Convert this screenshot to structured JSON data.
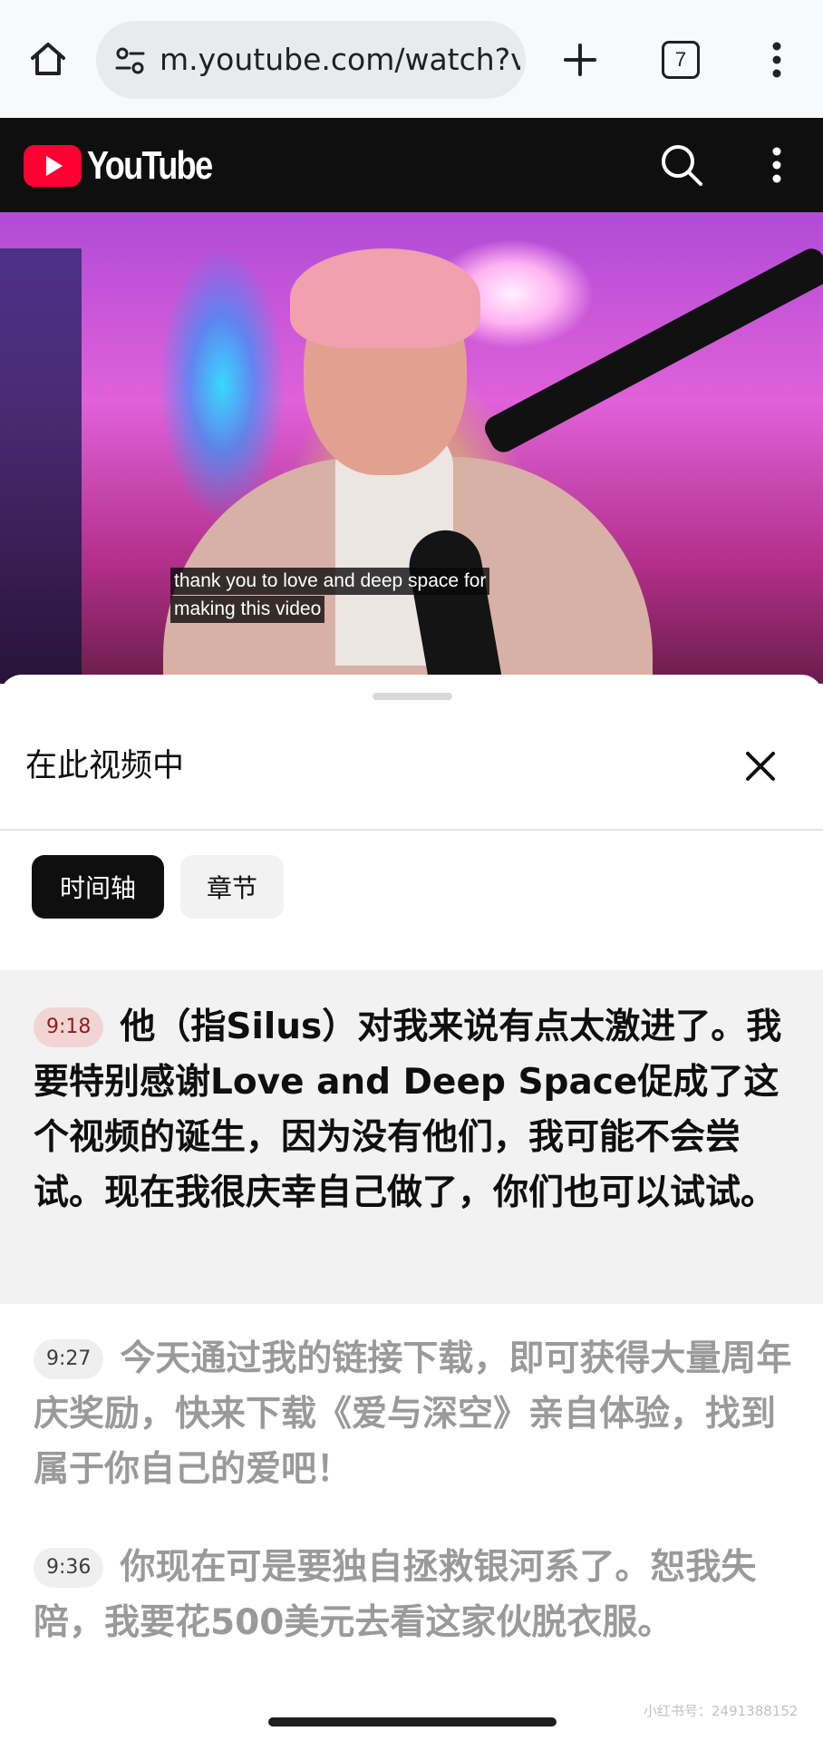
{
  "browser": {
    "url": "m.youtube.com/watch?v",
    "tab_count": "7"
  },
  "youtube": {
    "logo_text": "YouTube"
  },
  "video": {
    "caption_lines": [
      "thank you to love and deep space for",
      "making this video"
    ]
  },
  "sheet": {
    "title": "在此视频中",
    "chips": [
      {
        "label": "时间轴",
        "active": true
      },
      {
        "label": "章节",
        "active": false
      }
    ],
    "entries": [
      {
        "timestamp": "9:18",
        "text": "他（指Silus）对我来说有点太激进了。我要特别感谢Love and Deep Space促成了这个视频的诞生，因为没有他们，我可能不会尝试。现在我很庆幸自己做了，你们也可以试试。",
        "active": true
      },
      {
        "timestamp": "9:27",
        "text": "今天通过我的链接下载，即可获得大量周年庆奖励，快来下载《爱与深空》亲自体验，找到属于你自己的爱吧！",
        "active": false
      },
      {
        "timestamp": "9:36",
        "text": "你现在可是要独自拯救银河系了。恕我失陪，我要花500美元去看这家伙脱衣服。",
        "active": false
      }
    ]
  },
  "watermark": "小红书号：2491388152",
  "colors": {
    "youtube_red": "#ff0033",
    "header_bg": "#0f0f0f",
    "active_entry_bg": "#f2f2f2",
    "timestamp_active_bg": "#f2d5d2"
  }
}
